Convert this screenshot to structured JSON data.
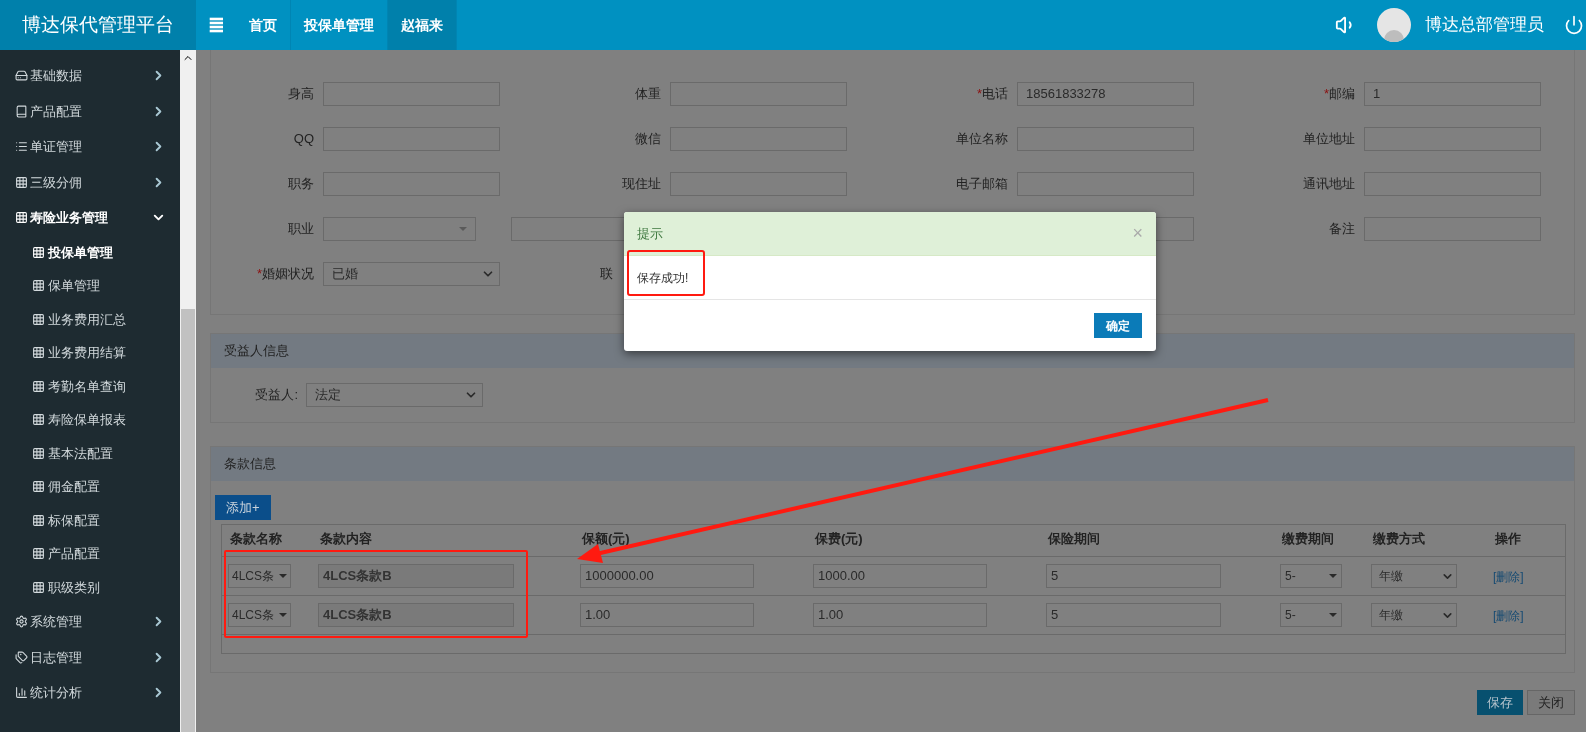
{
  "header": {
    "logo": "博达保代管理平台",
    "menu_icon": "≣",
    "nav": [
      {
        "label": "首页",
        "selected": false
      },
      {
        "label": "投保单管理",
        "selected": false
      },
      {
        "label": "赵福来",
        "selected": true
      }
    ],
    "user": "博达总部管理员"
  },
  "sidebar": {
    "items": [
      {
        "label": "基础数据",
        "expanded": false
      },
      {
        "label": "产品配置",
        "expanded": false
      },
      {
        "label": "单证管理",
        "expanded": false
      },
      {
        "label": "三级分佣",
        "expanded": false
      },
      {
        "label": "寿险业务管理",
        "expanded": true,
        "children": [
          {
            "label": "投保单管理",
            "selected": true
          },
          {
            "label": "保单管理",
            "selected": false
          },
          {
            "label": "业务费用汇总",
            "selected": false
          },
          {
            "label": "业务费用结算",
            "selected": false
          },
          {
            "label": "考勤名单查询",
            "selected": false
          },
          {
            "label": "寿险保单报表",
            "selected": false
          },
          {
            "label": "基本法配置",
            "selected": false
          },
          {
            "label": "佣金配置",
            "selected": false
          },
          {
            "label": "标保配置",
            "selected": false
          },
          {
            "label": "产品配置",
            "selected": false
          },
          {
            "label": "职级类别",
            "selected": false
          }
        ]
      },
      {
        "label": "系统管理",
        "expanded": false
      },
      {
        "label": "日志管理",
        "expanded": false
      },
      {
        "label": "统计分析",
        "expanded": false
      }
    ]
  },
  "form": {
    "rows": [
      [
        {
          "label": "身高",
          "kind": "input"
        },
        {
          "label": "体重",
          "kind": "input"
        },
        {
          "marker": "*",
          "label": "电话",
          "kind": "input",
          "value": "18561833278"
        },
        {
          "marker": "*",
          "label": "邮编",
          "kind": "input",
          "value": "1"
        }
      ],
      [
        {
          "label": "QQ",
          "kind": "input"
        },
        {
          "label": "微信",
          "kind": "input"
        },
        {
          "label": "单位名称",
          "kind": "input"
        },
        {
          "label": "单位地址",
          "kind": "input"
        }
      ],
      [
        {
          "label": "职务",
          "kind": "input"
        },
        {
          "label": "现住址",
          "kind": "input"
        },
        {
          "label": "电子邮箱",
          "kind": "input"
        },
        {
          "label": "通讯地址",
          "kind": "input"
        }
      ],
      [
        {
          "label": "职业",
          "kind": "combo"
        },
        {
          "kind": "input"
        },
        {
          "kind": "input"
        },
        {
          "label": "备注",
          "kind": "input"
        }
      ],
      [
        {
          "marker": "*",
          "label": "婚姻状况",
          "kind": "select",
          "value": "已婚"
        },
        {
          "label": "联",
          "kind": "none"
        }
      ]
    ]
  },
  "beneficiary": {
    "title": "受益人信息",
    "label": "受益人:",
    "value": "法定"
  },
  "clauses": {
    "title": "条款信息",
    "add_button": "添加+",
    "columns": [
      "条款名称",
      "条款内容",
      "保额(元)",
      "保费(元)",
      "保险期间",
      "缴费期间",
      "缴费方式",
      "操作"
    ],
    "rows": [
      {
        "name": "4LCS条",
        "content": "4LCS条款B",
        "amount": "1000000.00",
        "premium": "1000.00",
        "period": "5",
        "pay_period": "5-",
        "pay_mode": "年缴",
        "action": "[删除]"
      },
      {
        "name": "4LCS条",
        "content": "4LCS条款B",
        "amount": "1.00",
        "premium": "1.00",
        "period": "5",
        "pay_period": "5-",
        "pay_mode": "年缴",
        "action": "[删除]"
      }
    ]
  },
  "footer_buttons": [
    "保存",
    "关闭"
  ],
  "dialog": {
    "title": "提示",
    "close": "×",
    "message": "保存成功!",
    "ok": "确定"
  }
}
